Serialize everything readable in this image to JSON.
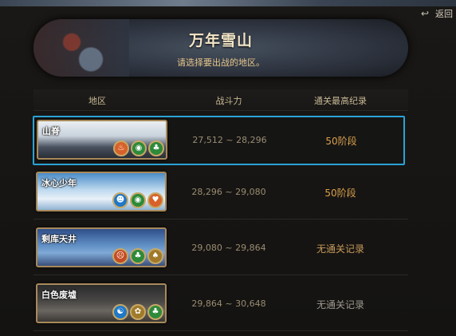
{
  "back": {
    "label": "返回",
    "icon": "return-arrow-icon"
  },
  "banner": {
    "title": "万年雪山",
    "subtitle": "请选择要出战的地区。"
  },
  "columns": {
    "region": "地区",
    "power": "战斗力",
    "record": "通关最高纪录"
  },
  "rows": [
    {
      "name": "山脊",
      "power": "27,512 ~ 28,296",
      "record": "50阶段",
      "selected": true,
      "badges": [
        {
          "icon": "fire-element-icon",
          "color": "#d8612a"
        },
        {
          "icon": "eye-element-icon",
          "color": "#2d8a3a"
        },
        {
          "icon": "leaf-element-icon",
          "color": "#2d8a3a"
        }
      ]
    },
    {
      "name": "冰心少年",
      "power": "28,296 ~ 29,080",
      "record": "50阶段",
      "selected": false,
      "badges": [
        {
          "icon": "water-element-icon",
          "color": "#1f78c8"
        },
        {
          "icon": "eye-element-icon",
          "color": "#2d8a3a"
        },
        {
          "icon": "heart-element-icon",
          "color": "#d8612a"
        }
      ]
    },
    {
      "name": "剩库天井",
      "power": "29,080 ~ 29,864",
      "record": "无通关记录",
      "selected": false,
      "badges": [
        {
          "icon": "skull-element-icon",
          "color": "#c44b22"
        },
        {
          "icon": "leaf-element-icon",
          "color": "#2d8a3a"
        },
        {
          "icon": "spade-element-icon",
          "color": "#a07a2a"
        }
      ]
    },
    {
      "name": "白色废墟",
      "power": "29,864 ~ 30,648",
      "record": "无通关记录",
      "selected": false,
      "badges": [
        {
          "icon": "triskelion-element-icon",
          "color": "#1f78c8"
        },
        {
          "icon": "paw-element-icon",
          "color": "#a07a2a"
        },
        {
          "icon": "leaf-element-icon",
          "color": "#2d8a3a"
        }
      ]
    }
  ]
}
